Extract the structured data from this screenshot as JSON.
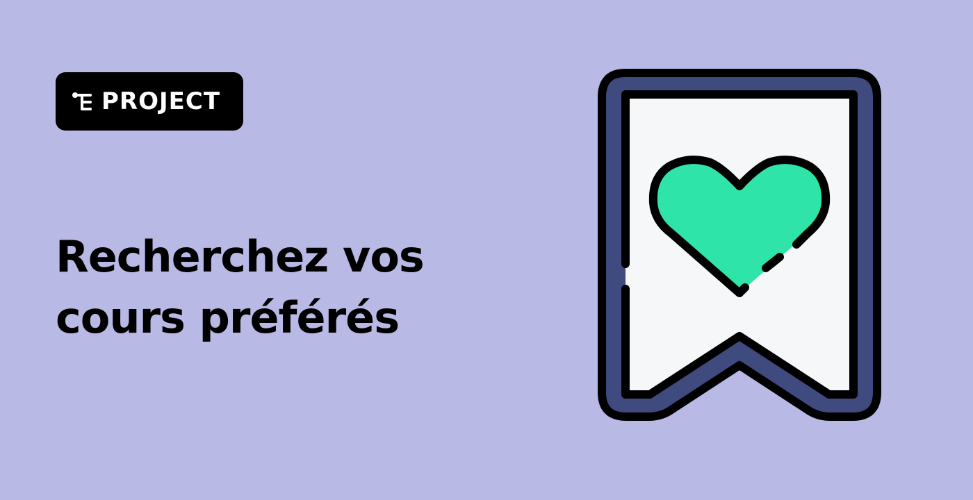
{
  "badge": {
    "label": "PROJECT",
    "logo_icon": "tree-logo-icon"
  },
  "headline": {
    "line1": "Recherchez vos",
    "line2": "cours préférés"
  },
  "illustration": {
    "icon": "bookmark-heart-icon"
  },
  "colors": {
    "background": "#b8b9e4",
    "badge_background": "#000000",
    "badge_text": "#ffffff",
    "headline_text": "#000000",
    "bookmark_frame": "#3f4a7e",
    "bookmark_inner": "#f6f7f9",
    "heart": "#2fe4a9",
    "outline": "#000000"
  }
}
